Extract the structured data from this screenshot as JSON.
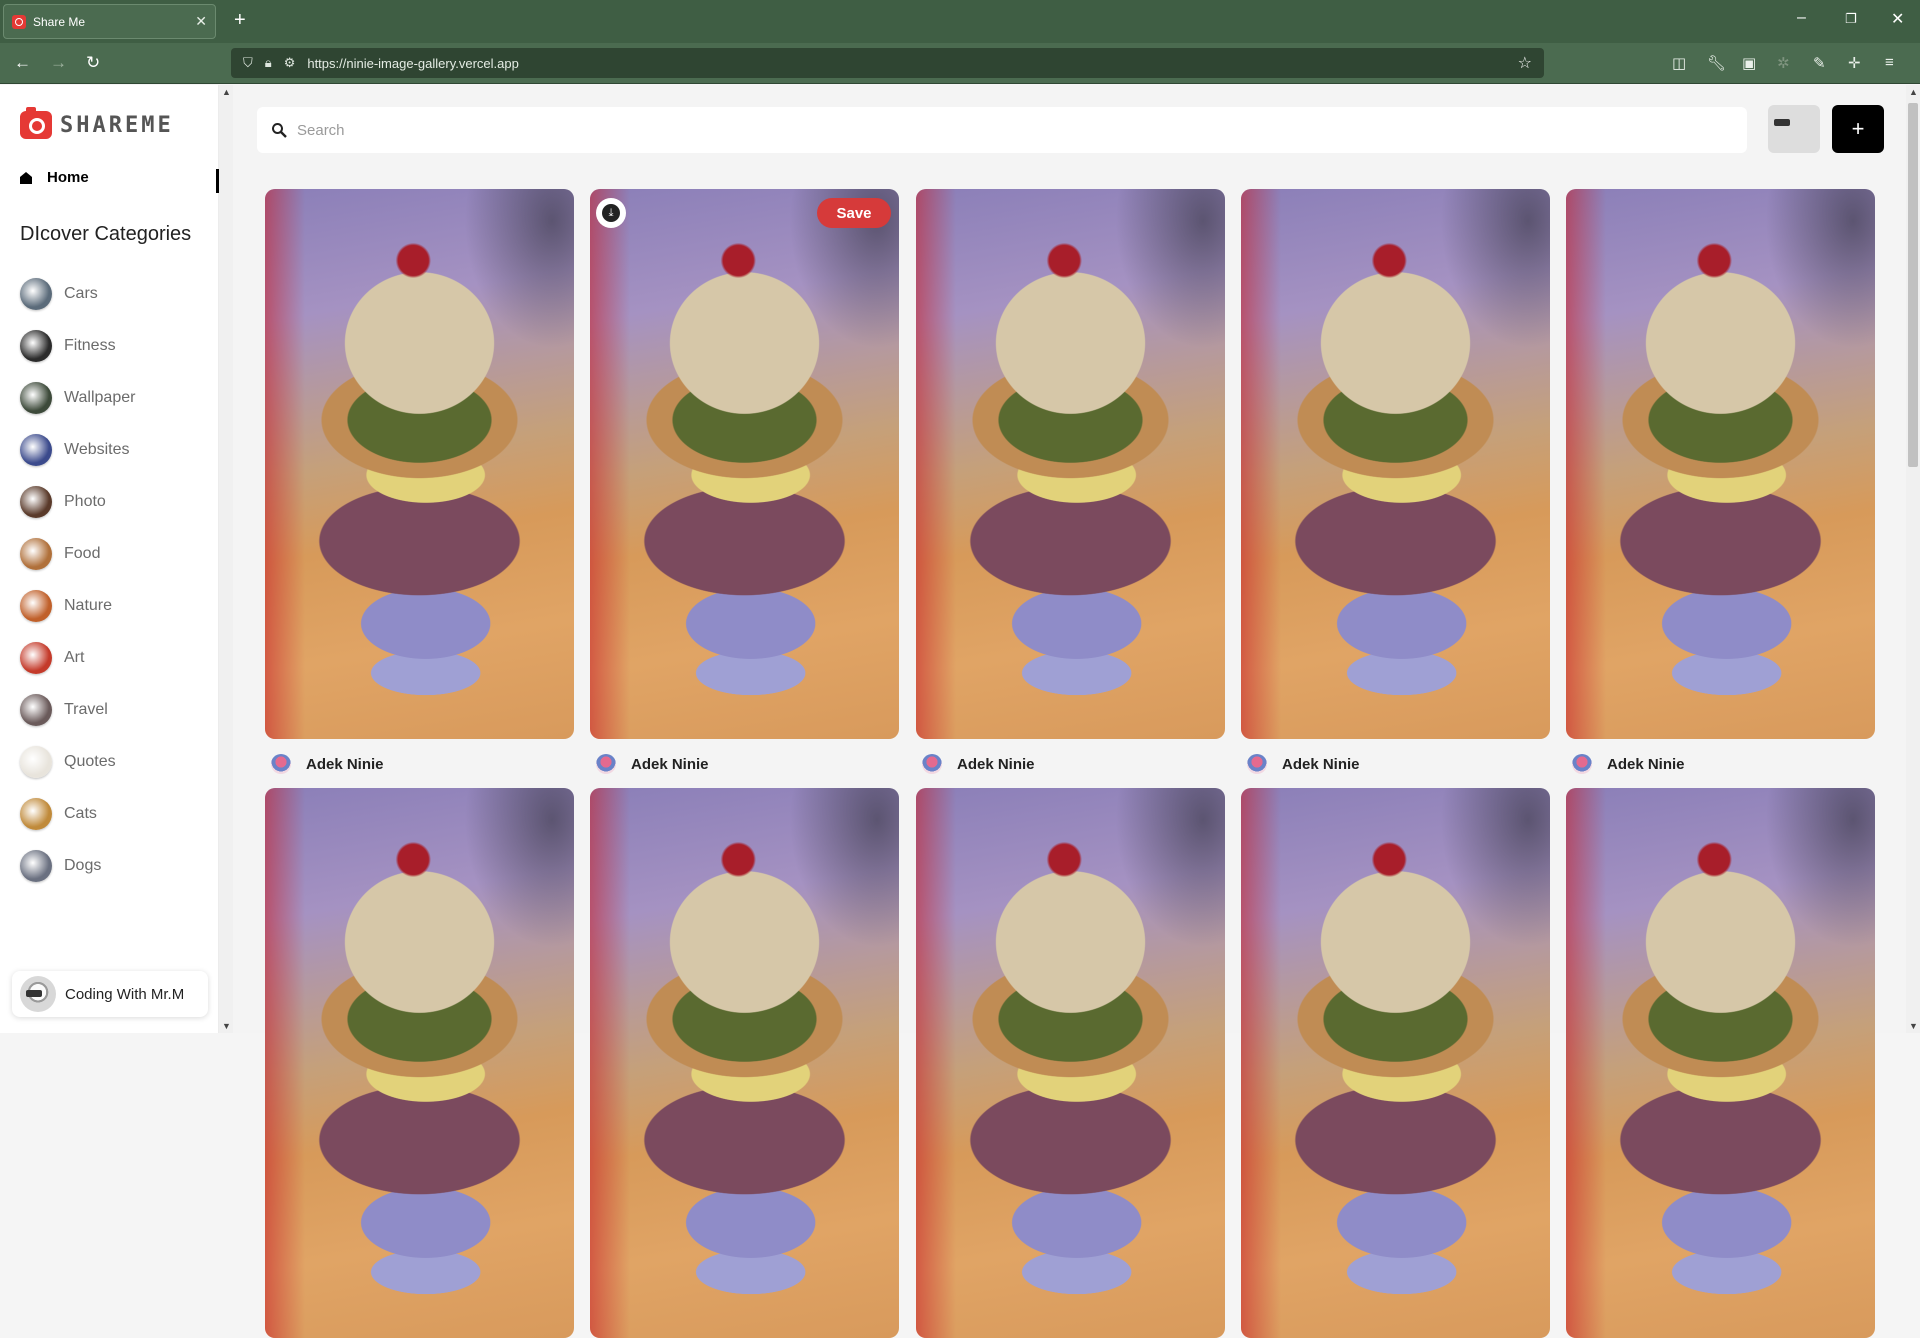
{
  "browser": {
    "tab_title": "Share Me",
    "new_tab_icon": "+",
    "url": "https://ninie-image-gallery.vercel.app",
    "window_controls": [
      "–",
      "❐",
      "✕"
    ]
  },
  "app": {
    "logo_text": "SHAREME",
    "home_label": "Home",
    "categories_heading": "DIcover Categories",
    "categories": [
      {
        "label": "Cars",
        "color": "#5b6b7a"
      },
      {
        "label": "Fitness",
        "color": "#2b2b2b"
      },
      {
        "label": "Wallpaper",
        "color": "#3d4a3a"
      },
      {
        "label": "Websites",
        "color": "#3b4a8c"
      },
      {
        "label": "Photo",
        "color": "#5a3a2a"
      },
      {
        "label": "Food",
        "color": "#b0703a"
      },
      {
        "label": "Nature",
        "color": "#c0602a"
      },
      {
        "label": "Art",
        "color": "#c43a2a"
      },
      {
        "label": "Travel",
        "color": "#6a5a5a"
      },
      {
        "label": "Quotes",
        "color": "#e8e4dc"
      },
      {
        "label": "Cats",
        "color": "#c08a3a"
      },
      {
        "label": "Dogs",
        "color": "#6a7080"
      }
    ],
    "profile_name": "Coding With Mr.M"
  },
  "search": {
    "placeholder": "Search",
    "value": ""
  },
  "add_button_label": "+",
  "pins": {
    "save_label": "Save",
    "download_icon": "⤓",
    "author": "Adek Ninie",
    "hovered_index": 1,
    "count": 10
  },
  "colors": {
    "save_red": "#d63a3a",
    "browser_green": "#3f5e44",
    "accent_black": "#000000"
  }
}
